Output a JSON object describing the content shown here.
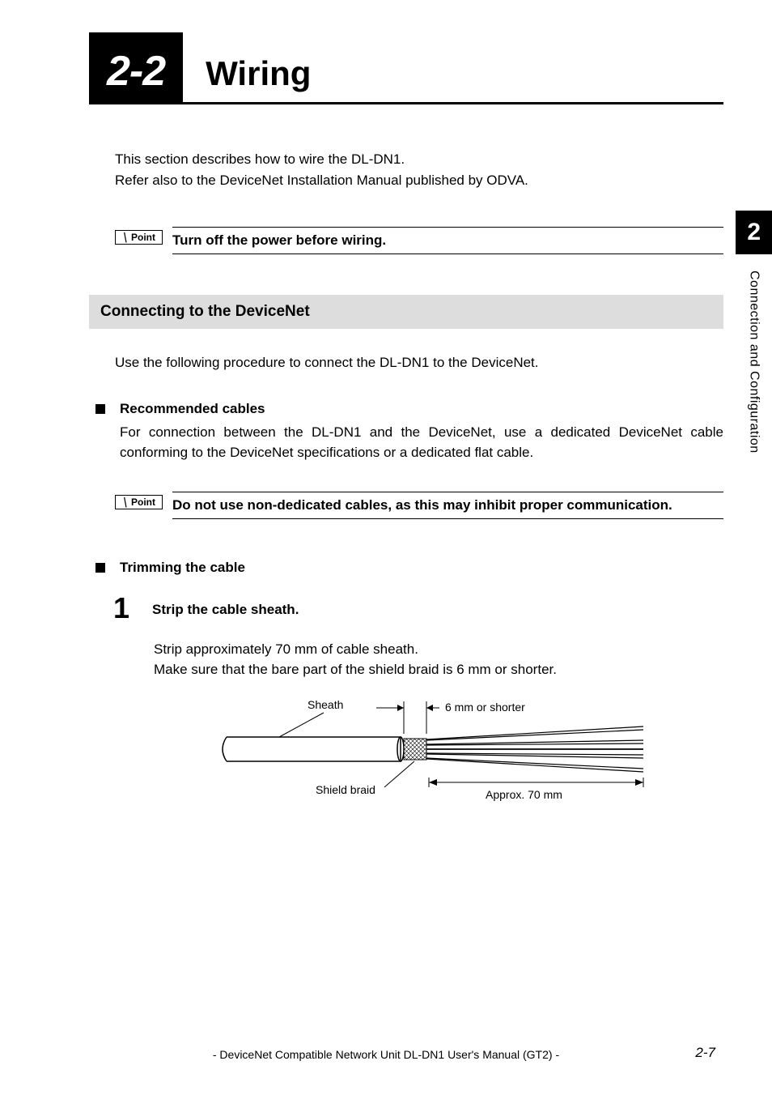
{
  "header": {
    "section_number": "2-2",
    "section_title": "Wiring"
  },
  "intro": {
    "line1": "This section describes how to wire the DL-DN1.",
    "line2": "Refer also to the DeviceNet Installation Manual published by ODVA."
  },
  "point1": {
    "label": "Point",
    "text": "Turn off the power before wiring."
  },
  "subsection": {
    "title": "Connecting to the DeviceNet",
    "intro": "Use the following procedure to connect the DL-DN1 to the DeviceNet."
  },
  "recommended": {
    "title": "Recommended cables",
    "body": "For connection between the DL-DN1 and the DeviceNet, use a dedicated DeviceNet cable conforming to the DeviceNet specifications or a dedicated flat cable."
  },
  "point2": {
    "label": "Point",
    "text": "Do not use non-dedicated cables, as this may inhibit proper communication."
  },
  "trimming": {
    "title": "Trimming the cable"
  },
  "step1": {
    "number": "1",
    "title": "Strip the cable sheath.",
    "body_line1": "Strip approximately 70 mm of cable sheath.",
    "body_line2": "Make sure that the bare part of the shield braid is 6 mm or shorter."
  },
  "diagram": {
    "sheath_label": "Sheath",
    "shield_label": "Shield braid",
    "short_label": "6 mm or shorter",
    "length_label": "Approx. 70 mm"
  },
  "side": {
    "chapter": "2",
    "label": "Connection and Configuration"
  },
  "footer": {
    "text": "- DeviceNet Compatible Network Unit DL-DN1 User's Manual (GT2) -",
    "page": "2-7"
  }
}
